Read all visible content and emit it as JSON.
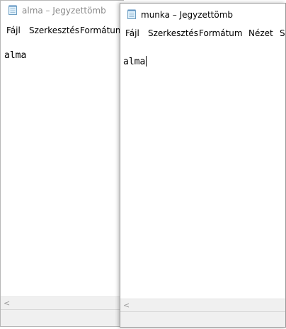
{
  "back_window": {
    "title": "alma – Jegyzettömb",
    "menu": [
      "Fájl",
      "Szerkesztés",
      "Formátum"
    ],
    "content": "alma",
    "scroll_left_glyph": "<"
  },
  "front_window": {
    "title": "munka – Jegyzettömb",
    "menu": [
      "Fájl",
      "Szerkesztés",
      "Formátum",
      "Nézet",
      "Sú"
    ],
    "content": "alma",
    "scroll_left_glyph": "<"
  },
  "icons": {
    "app": "notepad-icon"
  }
}
